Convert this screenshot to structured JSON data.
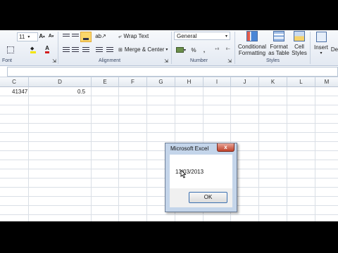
{
  "ribbon": {
    "font_size": "11",
    "font_group": "Font",
    "alignment_group": "Alignment",
    "number_group": "Number",
    "styles_group": "Styles",
    "wrap_text": "Wrap Text",
    "merge_center": "Merge & Center",
    "number_format": "General",
    "percent": "%",
    "comma": ",",
    "conditional_formatting": [
      "Conditional",
      "Formatting"
    ],
    "format_as_table": [
      "Format",
      "as Table"
    ],
    "cell_styles": [
      "Cell",
      "Styles"
    ],
    "insert": "Insert",
    "delete": "De"
  },
  "columns": [
    "C",
    "D",
    "E",
    "F",
    "G",
    "H",
    "I",
    "J",
    "K",
    "L",
    "M"
  ],
  "cells": {
    "c1": "41347",
    "d1": "0.5"
  },
  "dialog": {
    "title": "Microsoft Excel",
    "close": "x",
    "message": "13/03/2013",
    "ok": "OK"
  }
}
